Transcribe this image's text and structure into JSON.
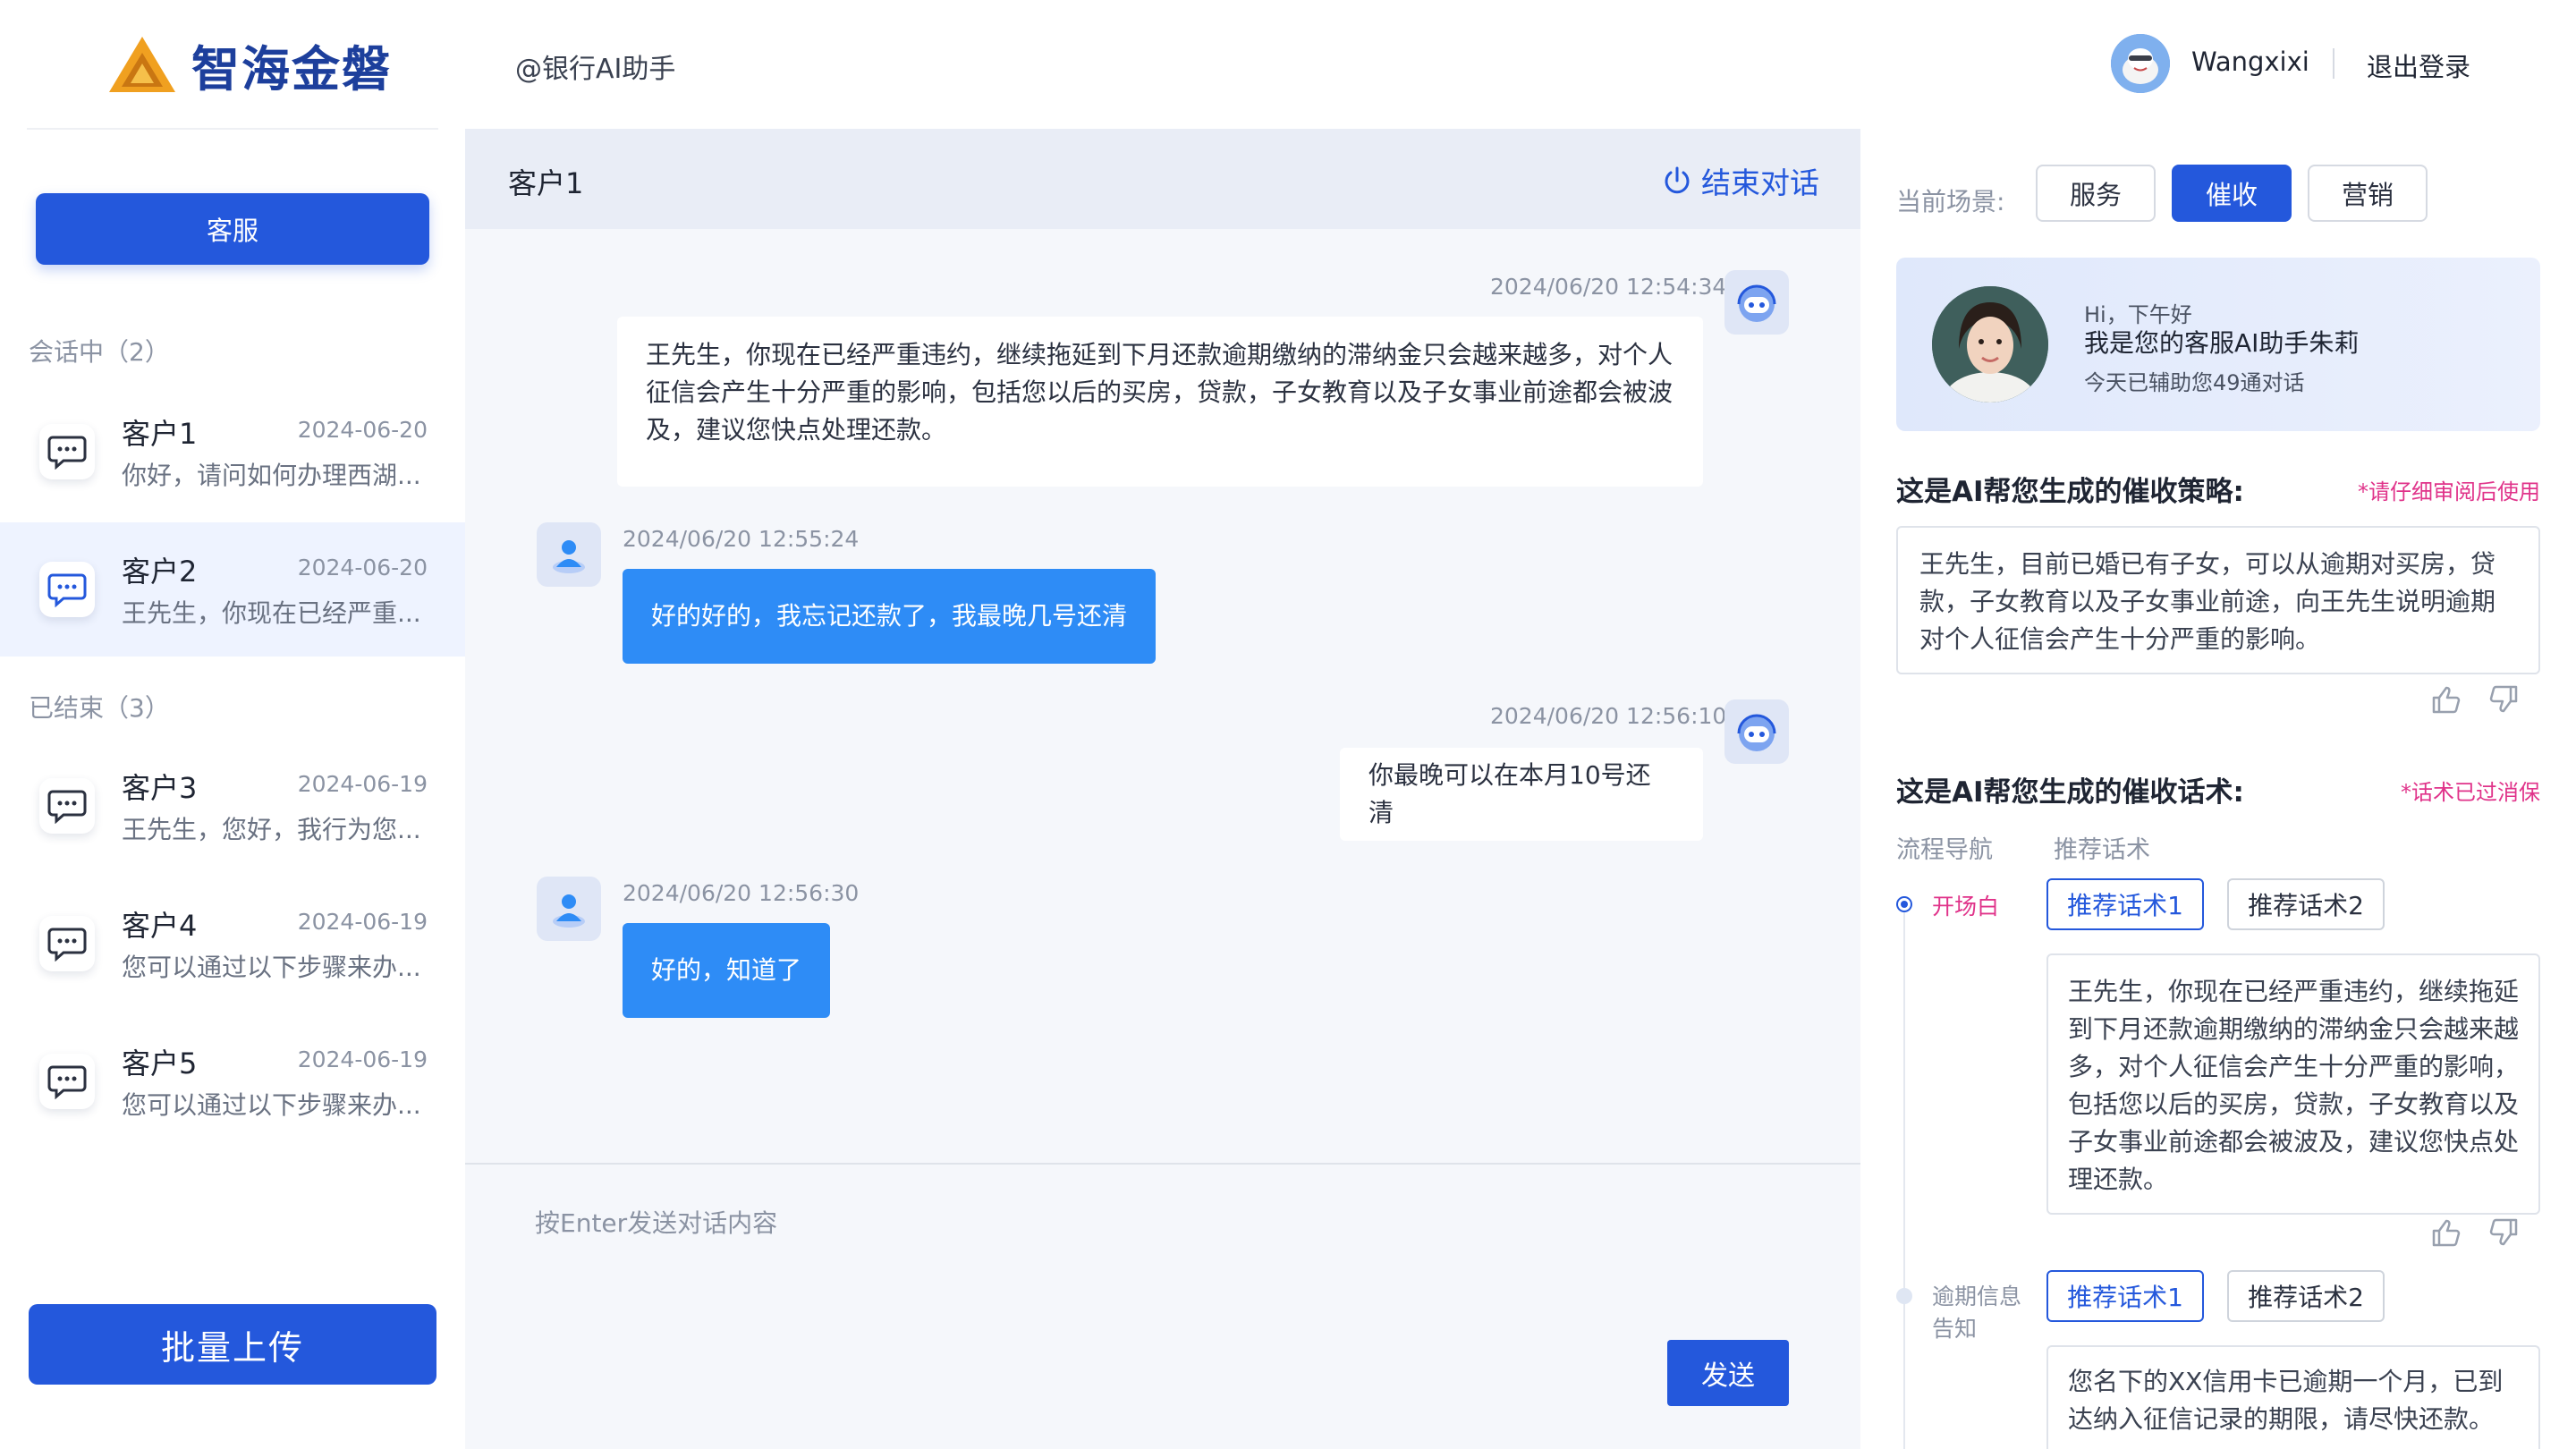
{
  "brand": {
    "name": "智海金磐"
  },
  "header": {
    "app_mention": "@银行AI助手",
    "username": "Wangxixi",
    "logout": "退出登录"
  },
  "sidebar": {
    "service_button": "客服",
    "active_section": "会话中（2）",
    "ended_section": "已结束（3）",
    "conversations": [
      {
        "name": "客户1",
        "date": "2024-06-20",
        "preview": "你好，请问如何办理西湖..."
      },
      {
        "name": "客户2",
        "date": "2024-06-20",
        "preview": "王先生，你现在已经严重..."
      },
      {
        "name": "客户3",
        "date": "2024-06-19",
        "preview": "王先生，您好，我行为您..."
      },
      {
        "name": "客户4",
        "date": "2024-06-19",
        "preview": "您可以通过以下步骤来办..."
      },
      {
        "name": "客户5",
        "date": "2024-06-19",
        "preview": "您可以通过以下步骤来办..."
      }
    ],
    "upload_button": "批量上传"
  },
  "chat": {
    "title": "客户1",
    "end_button": "结束对话",
    "messages": [
      {
        "from": "agent",
        "time": "2024/06/20 12:54:34",
        "text": "王先生，你现在已经严重违约，继续拖延到下月还款逾期缴纳的滞纳金只会越来越多，对个人征信会产生十分严重的影响，包括您以后的买房，贷款，子女教育以及子女事业前途都会被波及，建议您快点处理还款。"
      },
      {
        "from": "customer",
        "time": "2024/06/20 12:55:24",
        "text": "好的好的，我忘记还款了，我最晚几号还清"
      },
      {
        "from": "agent",
        "time": "2024/06/20 12:56:10",
        "text": "你最晚可以在本月10号还清"
      },
      {
        "from": "customer",
        "time": "2024/06/20 12:56:30",
        "text": "好的，知道了"
      }
    ],
    "input_placeholder": "按Enter发送对话内容",
    "send_button": "发送"
  },
  "right": {
    "scene_label": "当前场景:",
    "scenes": [
      "服务",
      "催收",
      "营销"
    ],
    "active_scene": "催收",
    "assistant": {
      "greeting": "Hi，下午好",
      "intro": "我是您的客服AI助手朱莉",
      "stats": "今天已辅助您49通对话"
    },
    "strategy": {
      "title": "这是AI帮您生成的催收策略:",
      "note": "*请仔细审阅后使用",
      "text": "王先生，目前已婚已有子女，可以从逾期对买房，贷款，子女教育以及子女事业前途，向王先生说明逾期对个人征信会产生十分严重的影响。"
    },
    "script": {
      "title": "这是AI帮您生成的催收话术:",
      "note": "*话术已过消保",
      "col_flow": "流程导航",
      "col_script": "推荐话术",
      "steps": [
        {
          "label": "开场白",
          "options": [
            "推荐话术1",
            "推荐话术2"
          ],
          "text": "王先生，你现在已经严重违约，继续拖延到下月还款逾期缴纳的滞纳金只会越来越多，对个人征信会产生十分严重的影响，包括您以后的买房，贷款，子女教育以及子女事业前途都会被波及，建议您快点处理还款。"
        },
        {
          "label": "逾期信息告知",
          "options": [
            "推荐话术1",
            "推荐话术2"
          ],
          "text": "您名下的XX信用卡已逾期一个月，已到达纳入征信记录的期限，请尽快还款。"
        }
      ]
    }
  },
  "colors": {
    "primary": "#2458dc",
    "customer_bubble": "#2e8cf6",
    "note_pink": "#e0338a",
    "brand_navy": "#1d3f9c",
    "logo_orange": "#f0a020"
  }
}
